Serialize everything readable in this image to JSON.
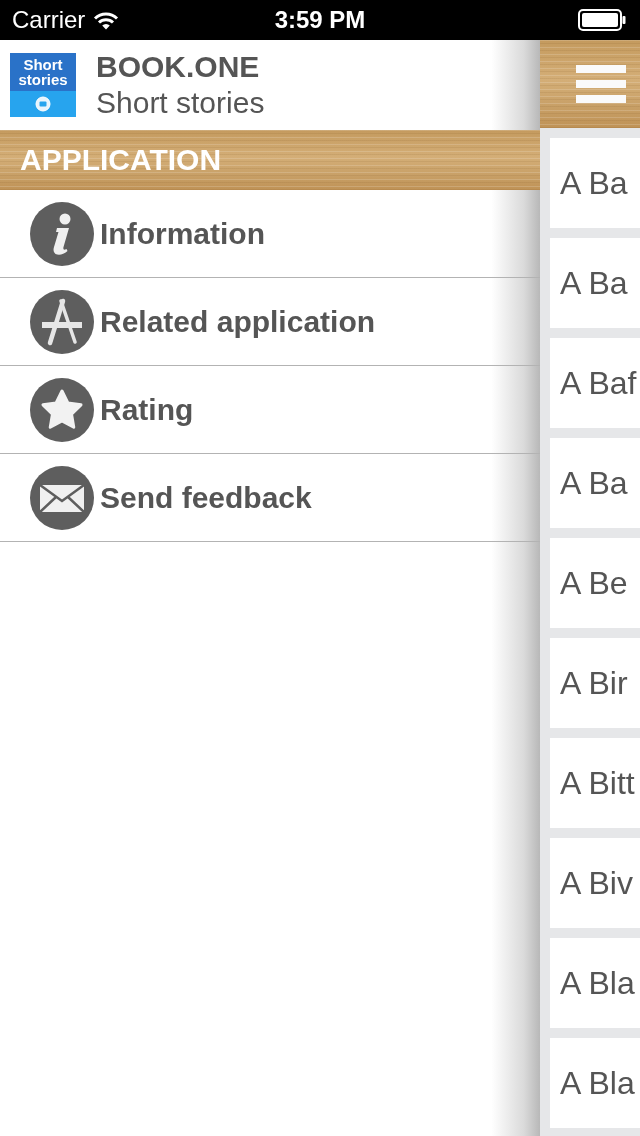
{
  "status_bar": {
    "carrier": "Carrier",
    "time": "3:59 PM"
  },
  "drawer": {
    "logo_lines": [
      "Short",
      "stories"
    ],
    "title": "BOOK.ONE",
    "subtitle": "Short stories",
    "section_title": "APPLICATION",
    "items": [
      {
        "kind": "info",
        "label": "Information"
      },
      {
        "kind": "store",
        "label": "Related application"
      },
      {
        "kind": "star",
        "label": "Rating"
      },
      {
        "kind": "mail",
        "label": "Send feedback"
      }
    ]
  },
  "stories": [
    {
      "title": "A Ba"
    },
    {
      "title": "A Ba"
    },
    {
      "title": "A Baf"
    },
    {
      "title": "A Ba"
    },
    {
      "title": "A Be"
    },
    {
      "title": "A Bir"
    },
    {
      "title": "A Bitt"
    },
    {
      "title": "A Biv"
    },
    {
      "title": "A Bla"
    },
    {
      "title": "A Bla"
    }
  ]
}
